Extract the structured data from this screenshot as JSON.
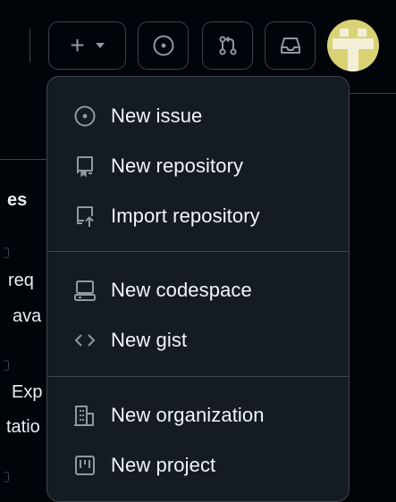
{
  "header": {
    "create_button": {
      "plus": "+",
      "icon": "plus-icon"
    },
    "issues_button": {
      "icon": "issue-opened-icon"
    },
    "pull_requests_button": {
      "icon": "git-pull-request-icon"
    },
    "inbox_button": {
      "icon": "inbox-icon"
    },
    "avatar": {
      "colors": [
        "#d8d275",
        "#f3efd6"
      ]
    }
  },
  "background": {
    "heading_fragment": "es",
    "line_1": "req",
    "line_2": "ava",
    "line_3": "Exp",
    "line_4": "tatio"
  },
  "menu": {
    "groups": [
      {
        "items": [
          {
            "label": "New issue",
            "icon": "issue-opened-icon"
          },
          {
            "label": "New repository",
            "icon": "repo-icon"
          },
          {
            "label": "Import repository",
            "icon": "repo-push-icon"
          }
        ]
      },
      {
        "items": [
          {
            "label": "New codespace",
            "icon": "codespaces-icon"
          },
          {
            "label": "New gist",
            "icon": "code-icon"
          }
        ]
      },
      {
        "items": [
          {
            "label": "New organization",
            "icon": "organization-icon"
          },
          {
            "label": "New project",
            "icon": "project-icon"
          }
        ]
      }
    ]
  },
  "colors": {
    "page_bg": "#010409",
    "menu_bg": "#151b23",
    "border": "#3d444d",
    "text": "#f0f6fc",
    "muted": "#9198a1"
  }
}
